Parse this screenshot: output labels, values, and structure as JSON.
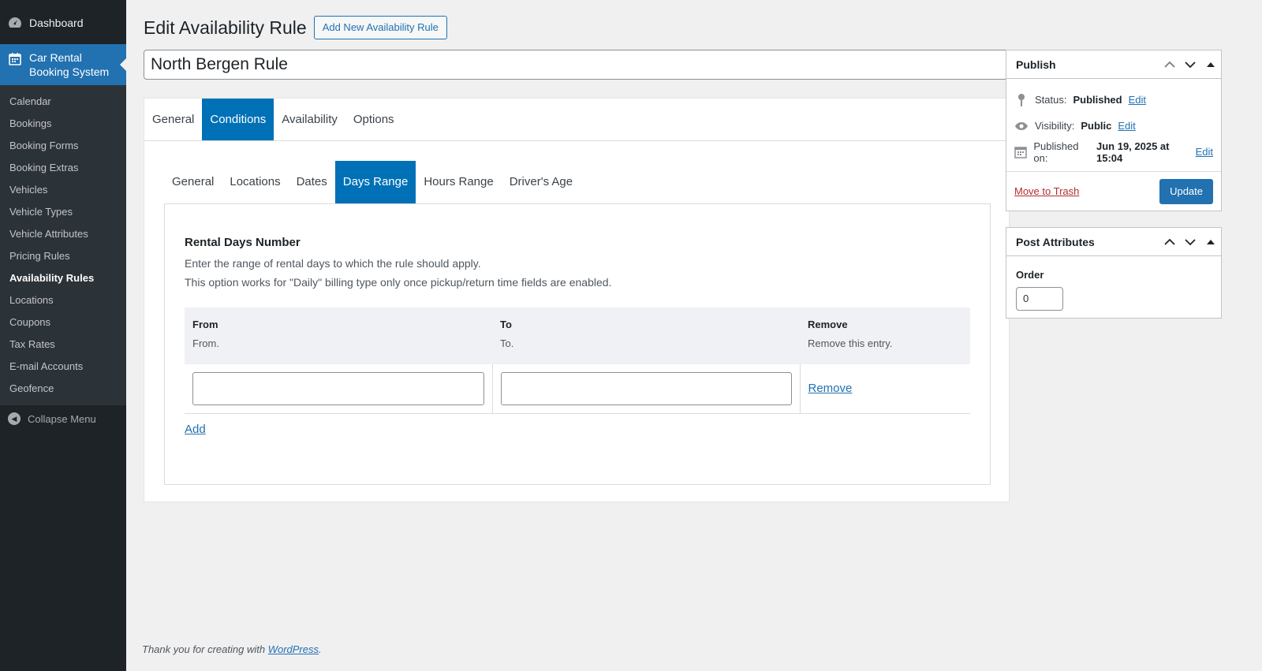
{
  "sidebar": {
    "dashboard": {
      "label": "Dashboard",
      "icon": "dashboard-icon"
    },
    "current": {
      "label": "Car Rental Booking System",
      "icon": "calendar-icon"
    },
    "items": [
      {
        "label": "Calendar"
      },
      {
        "label": "Bookings"
      },
      {
        "label": "Booking Forms"
      },
      {
        "label": "Booking Extras"
      },
      {
        "label": "Vehicles"
      },
      {
        "label": "Vehicle Types"
      },
      {
        "label": "Vehicle Attributes"
      },
      {
        "label": "Pricing Rules"
      },
      {
        "label": "Availability Rules"
      },
      {
        "label": "Locations"
      },
      {
        "label": "Coupons"
      },
      {
        "label": "Tax Rates"
      },
      {
        "label": "E-mail Accounts"
      },
      {
        "label": "Geofence"
      }
    ],
    "current_item": "Availability Rules",
    "collapse_label": "Collapse Menu"
  },
  "header": {
    "title": "Edit Availability Rule",
    "add_new_label": "Add New Availability Rule",
    "post_title": "North Bergen Rule"
  },
  "main_tabs": [
    "General",
    "Conditions",
    "Availability",
    "Options"
  ],
  "main_tab_active": "Conditions",
  "sub_tabs": [
    "General",
    "Locations",
    "Dates",
    "Days Range",
    "Hours Range",
    "Driver's Age"
  ],
  "sub_tab_active": "Days Range",
  "panel": {
    "heading": "Rental Days Number",
    "desc1": "Enter the range of rental days to which the rule should apply.",
    "desc2": "This option works for \"Daily\" billing type only once pickup/return time fields are enabled.",
    "columns": [
      {
        "label": "From",
        "desc": "From."
      },
      {
        "label": "To",
        "desc": "To."
      },
      {
        "label": "Remove",
        "desc": "Remove this entry."
      }
    ],
    "row": {
      "from": "",
      "to": "",
      "remove_label": "Remove"
    },
    "add_label": "Add"
  },
  "publish": {
    "title": "Publish",
    "status_label": "Status:",
    "status_value": "Published",
    "visibility_label": "Visibility:",
    "visibility_value": "Public",
    "published_label": "Published on:",
    "published_value": "Jun 19, 2025 at 15:04",
    "edit_label": "Edit",
    "trash_label": "Move to Trash",
    "update_label": "Update"
  },
  "attributes": {
    "title": "Post Attributes",
    "order_label": "Order",
    "order_value": "0"
  },
  "footer": {
    "text": "Thank you for creating with ",
    "link": "WordPress",
    "end": "."
  },
  "colors": {
    "accent": "#2271b1",
    "tab_active": "#0071b6",
    "sidebar": "#1d2327",
    "trash": "#b32d2e"
  }
}
